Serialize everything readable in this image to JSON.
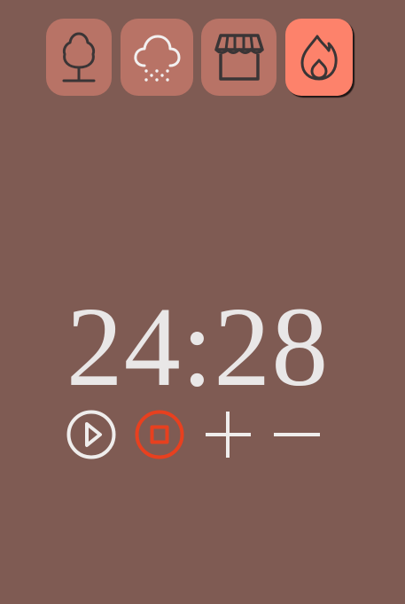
{
  "sounds": [
    {
      "id": "forest",
      "icon": "tree-icon",
      "active": false
    },
    {
      "id": "rain",
      "icon": "cloud-rain-icon",
      "active": false
    },
    {
      "id": "coffee-shop",
      "icon": "storefront-icon",
      "active": false
    },
    {
      "id": "fireplace",
      "icon": "flame-icon",
      "active": true
    }
  ],
  "timer": {
    "display": "24:28"
  },
  "controls": [
    {
      "id": "play",
      "icon": "play-circle-icon"
    },
    {
      "id": "stop",
      "icon": "stop-circle-icon"
    },
    {
      "id": "increase",
      "icon": "plus-icon"
    },
    {
      "id": "decrease",
      "icon": "minus-icon"
    }
  ],
  "colors": {
    "background": "#7f5b53",
    "sound_button": "#b87366",
    "sound_button_active": "#fd826b",
    "icon_dark": "#3a3536",
    "icon_light": "#f2f0f0",
    "timer_text": "#e9e7e7",
    "stop_accent": "#e8401f"
  }
}
